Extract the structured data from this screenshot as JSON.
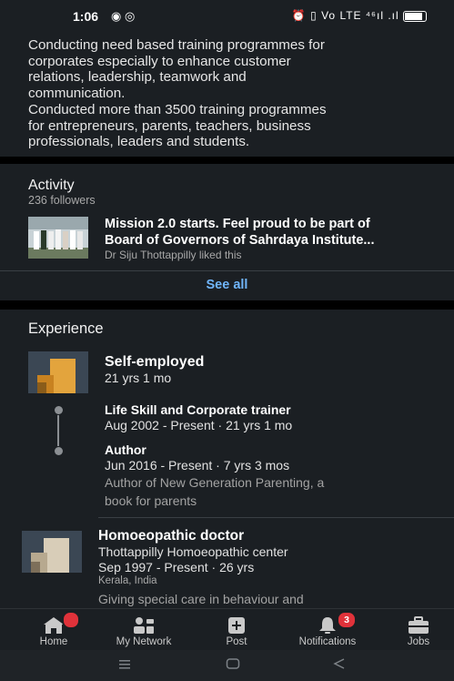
{
  "status_bar": {
    "time": "1:06",
    "app_icons": "◉ ◎",
    "right_indicators": "⏰ ▯ Vo LTE ⁴⁶ıl .ıl"
  },
  "about": {
    "text_lines": [
      "Conducting need based training programmes for",
      "corporates especially to enhance customer",
      "relations, leadership, teamwork and",
      "communication.",
      "Conducted more than 3500 training programmes",
      "for entrepreneurs, parents, teachers, business",
      "professionals, leaders and students."
    ]
  },
  "activity": {
    "title": "Activity",
    "followers": "236 followers",
    "post_title_line1": "Mission 2.0 starts. Feel proud to be part of",
    "post_title_line2": "Board of Governors of Sahrdaya Institute...",
    "post_meta": "Dr Siju Thottappilly liked this",
    "see_all": "See all"
  },
  "experience": {
    "title": "Experience",
    "company1": {
      "name": "Self-employed",
      "duration": "21 yrs 1 mo",
      "roles": [
        {
          "title": "Life Skill and Corporate trainer",
          "dates": "Aug 2002 - Present  ·  21 yrs 1 mo"
        },
        {
          "title": "Author",
          "dates": "Jun 2016 - Present  ·  7 yrs 3 mos",
          "desc_line1": "Author of New Generation Parenting, a",
          "desc_line2": "book for parents"
        }
      ]
    },
    "company2": {
      "title": "Homoeopathic doctor",
      "org": "Thottappilly Homoeopathic center",
      "dates": "Sep 1997 - Present  ·  26 yrs",
      "location": "Kerala, India",
      "desc": "Giving special care in behaviour and"
    }
  },
  "bottom_nav": {
    "items": [
      {
        "label": "Home",
        "icon": "home-icon"
      },
      {
        "label": "My Network",
        "icon": "network-icon"
      },
      {
        "label": "Post",
        "icon": "post-icon"
      },
      {
        "label": "Notifications",
        "icon": "bell-icon",
        "badge": "3"
      },
      {
        "label": "Jobs",
        "icon": "briefcase-icon"
      }
    ]
  },
  "colors": {
    "background": "#1b1f23",
    "link": "#70b5f9",
    "badge": "#e0323a"
  }
}
